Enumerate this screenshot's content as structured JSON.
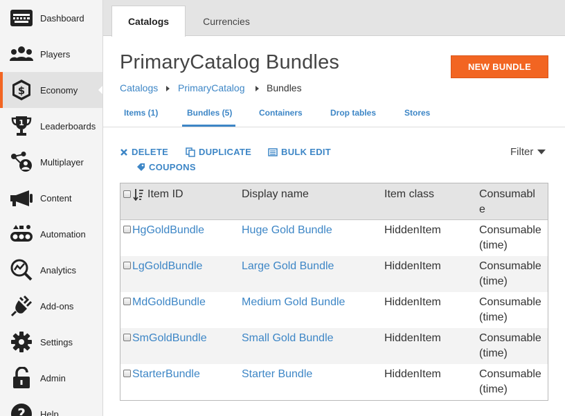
{
  "sidebar": {
    "items": [
      {
        "label": "Dashboard",
        "icon": "dashboard-icon"
      },
      {
        "label": "Players",
        "icon": "players-icon"
      },
      {
        "label": "Economy",
        "icon": "economy-icon"
      },
      {
        "label": "Leaderboards",
        "icon": "trophy-icon"
      },
      {
        "label": "Multiplayer",
        "icon": "multiplayer-icon"
      },
      {
        "label": "Content",
        "icon": "megaphone-icon"
      },
      {
        "label": "Automation",
        "icon": "automation-icon"
      },
      {
        "label": "Analytics",
        "icon": "analytics-icon"
      },
      {
        "label": "Add-ons",
        "icon": "plug-icon"
      },
      {
        "label": "Settings",
        "icon": "gear-icon"
      },
      {
        "label": "Admin",
        "icon": "lock-icon"
      },
      {
        "label": "Help",
        "icon": "help-icon"
      }
    ],
    "active": "Economy"
  },
  "tabs": [
    {
      "label": "Catalogs"
    },
    {
      "label": "Currencies"
    }
  ],
  "page": {
    "title": "PrimaryCatalog Bundles",
    "new_button": "NEW BUNDLE"
  },
  "breadcrumb": {
    "items": [
      "Catalogs",
      "PrimaryCatalog",
      "Bundles"
    ]
  },
  "subtabs": [
    {
      "label": "Items (1)"
    },
    {
      "label": "Bundles (5)"
    },
    {
      "label": "Containers"
    },
    {
      "label": "Drop tables"
    },
    {
      "label": "Stores"
    }
  ],
  "actions": {
    "delete": "DELETE",
    "duplicate": "DUPLICATE",
    "bulk_edit": "BULK EDIT",
    "coupons": "COUPONS",
    "filter": "Filter"
  },
  "table": {
    "headers": {
      "item_id": "Item ID",
      "display_name": "Display name",
      "item_class": "Item class",
      "consumable_1": "Consumabl",
      "consumable_2": "e"
    },
    "rows": [
      {
        "item_id": "HgGoldBundle",
        "display_name": "Huge Gold Bundle",
        "item_class": "HiddenItem",
        "consumable_1": "Consumable",
        "consumable_2": "(time)"
      },
      {
        "item_id": "LgGoldBundle",
        "display_name": "Large Gold Bundle",
        "item_class": "HiddenItem",
        "consumable_1": "Consumable",
        "consumable_2": "(time)"
      },
      {
        "item_id": "MdGoldBundle",
        "display_name": "Medium Gold Bundle",
        "item_class": "HiddenItem",
        "consumable_1": "Consumable",
        "consumable_2": "(time)"
      },
      {
        "item_id": "SmGoldBundle",
        "display_name": "Small Gold Bundle",
        "item_class": "HiddenItem",
        "consumable_1": "Consumable",
        "consumable_2": "(time)"
      },
      {
        "item_id": "StarterBundle",
        "display_name": "Starter Bundle",
        "item_class": "HiddenItem",
        "consumable_1": "Consumable",
        "consumable_2": "(time)"
      }
    ]
  },
  "colors": {
    "accent": "#f26522",
    "link": "#3d86c6"
  }
}
